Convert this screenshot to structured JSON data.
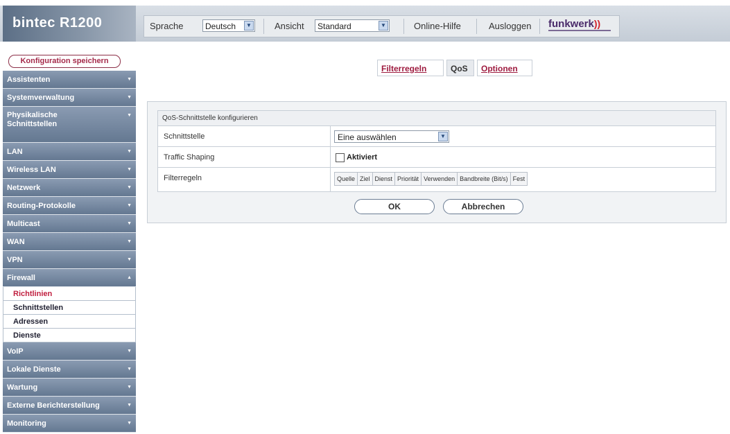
{
  "header": {
    "product": "bintec R1200",
    "language_label": "Sprache",
    "language_value": "Deutsch",
    "view_label": "Ansicht",
    "view_value": "Standard",
    "help_label": "Online-Hilfe",
    "logout_label": "Ausloggen",
    "brand": "funkwerk"
  },
  "sidebar": {
    "save_label": "Konfiguration speichern",
    "items": [
      {
        "label": "Assistenten"
      },
      {
        "label": "Systemverwaltung"
      },
      {
        "label": "Physikalische Schnittstellen"
      },
      {
        "label": "LAN"
      },
      {
        "label": "Wireless LAN"
      },
      {
        "label": "Netzwerk"
      },
      {
        "label": "Routing-Protokolle"
      },
      {
        "label": "Multicast"
      },
      {
        "label": "WAN"
      },
      {
        "label": "VPN"
      },
      {
        "label": "Firewall"
      },
      {
        "label": "VoIP"
      },
      {
        "label": "Lokale Dienste"
      },
      {
        "label": "Wartung"
      },
      {
        "label": "Externe Berichterstellung"
      },
      {
        "label": "Monitoring"
      }
    ],
    "firewall_sub": [
      "Richtlinien",
      "Schnittstellen",
      "Adressen",
      "Dienste"
    ]
  },
  "tabs": [
    "Filterregeln",
    "QoS",
    "Optionen"
  ],
  "form": {
    "section_title": "QoS-Schnittstelle konfigurieren",
    "interface_label": "Schnittstelle",
    "interface_value": "Eine auswählen",
    "traffic_label": "Traffic Shaping",
    "traffic_checkbox_label": "Aktiviert",
    "filter_label": "Filterregeln",
    "filter_columns": [
      "Quelle",
      "Ziel",
      "Dienst",
      "Priorität",
      "Verwenden",
      "Bandbreite (Bit/s)",
      "Fest"
    ],
    "ok_label": "OK",
    "cancel_label": "Abbrechen"
  },
  "colors": {
    "accent": "#a42a4a",
    "nav_bg": "#7689a3"
  }
}
